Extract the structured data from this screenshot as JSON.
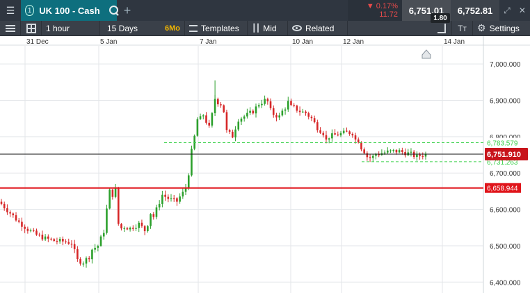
{
  "titlebar": {
    "tab_number": "1",
    "instrument": "UK 100 - Cash",
    "change_pct": "▼ 0.17%",
    "change_pts": "11.72",
    "sell": "6,751.01",
    "buy": "6,752.81",
    "spread": "1.80"
  },
  "toolbar": {
    "interval": "1 hour",
    "range": "15 Days",
    "range_tag": "6Mo",
    "templates": "Templates",
    "price_type": "Mid",
    "related": "Related",
    "settings": "Settings"
  },
  "colors": {
    "up": "#2ca02c",
    "down": "#d62728",
    "support_line": "#e0151b",
    "bracket_line": "#3ad14a",
    "current_line": "#111111",
    "current_badge": "#c8141b"
  },
  "chart_data": {
    "type": "candlestick",
    "x_tick_labels": [
      "31 Dec",
      "5 Jan",
      "7 Jan",
      "10 Jan",
      "12 Jan",
      "14 Jan"
    ],
    "y_ticks": [
      6400,
      6500,
      6600,
      6700,
      6800,
      6900,
      7000
    ],
    "y_tick_labels": [
      "6,400.000",
      "6,500.000",
      "6,600.000",
      "6,700.000",
      "6,800.000",
      "6,900.000",
      "7,000.000"
    ],
    "ylim": [
      6370,
      7050
    ],
    "current_price": 6751.91,
    "current_label": "6,751.910",
    "horizontal_line": {
      "value": 6658.944,
      "label": "6,658.944"
    },
    "bracket_upper": {
      "value": 6783.579,
      "label": "6,783.579"
    },
    "bracket_lower": {
      "value": 6731.263,
      "label": "6,731.263"
    },
    "close_path": [
      [
        0,
        6615
      ],
      [
        3,
        6590
      ],
      [
        6,
        6565
      ],
      [
        9,
        6545
      ],
      [
        12,
        6530
      ],
      [
        15,
        6520
      ],
      [
        18,
        6514
      ],
      [
        21,
        6512
      ],
      [
        24,
        6508
      ],
      [
        26,
        6460
      ],
      [
        28,
        6455
      ],
      [
        30,
        6470
      ],
      [
        31,
        6490
      ],
      [
        33,
        6500
      ],
      [
        35,
        6540
      ],
      [
        36,
        6600
      ],
      [
        37,
        6650
      ],
      [
        38,
        6640
      ],
      [
        39,
        6655
      ],
      [
        40,
        6560
      ],
      [
        41,
        6548
      ],
      [
        42,
        6552
      ],
      [
        44,
        6548
      ],
      [
        46,
        6556
      ],
      [
        47,
        6560
      ],
      [
        49,
        6542
      ],
      [
        50,
        6560
      ],
      [
        51,
        6590
      ],
      [
        52,
        6580
      ],
      [
        53,
        6600
      ],
      [
        55,
        6640
      ],
      [
        57,
        6630
      ],
      [
        59,
        6624
      ],
      [
        60,
        6622
      ],
      [
        61,
        6635
      ],
      [
        62,
        6645
      ],
      [
        63,
        6660
      ],
      [
        64,
        6700
      ],
      [
        65,
        6760
      ],
      [
        66,
        6800
      ],
      [
        67,
        6848
      ],
      [
        68,
        6850
      ],
      [
        69,
        6860
      ],
      [
        70,
        6842
      ],
      [
        71,
        6825
      ],
      [
        72,
        6860
      ],
      [
        73,
        6905
      ],
      [
        74,
        6895
      ],
      [
        75,
        6890
      ],
      [
        76,
        6870
      ],
      [
        77,
        6815
      ],
      [
        78,
        6808
      ],
      [
        79,
        6802
      ],
      [
        80,
        6825
      ],
      [
        81,
        6848
      ],
      [
        82,
        6852
      ],
      [
        84,
        6860
      ],
      [
        86,
        6870
      ],
      [
        88,
        6890
      ],
      [
        90,
        6900
      ],
      [
        91,
        6896
      ],
      [
        92,
        6872
      ],
      [
        93,
        6862
      ],
      [
        94,
        6858
      ],
      [
        95,
        6855
      ],
      [
        96,
        6870
      ],
      [
        97,
        6880
      ],
      [
        98,
        6895
      ],
      [
        99,
        6882
      ],
      [
        100,
        6880
      ],
      [
        102,
        6870
      ],
      [
        104,
        6865
      ],
      [
        106,
        6850
      ],
      [
        108,
        6825
      ],
      [
        110,
        6810
      ],
      [
        111,
        6790
      ],
      [
        112,
        6800
      ],
      [
        114,
        6805
      ],
      [
        116,
        6808
      ],
      [
        118,
        6812
      ],
      [
        120,
        6810
      ],
      [
        121,
        6792
      ],
      [
        122,
        6790
      ],
      [
        123,
        6770
      ],
      [
        124,
        6760
      ],
      [
        125,
        6745
      ],
      [
        126,
        6742
      ],
      [
        127,
        6745
      ],
      [
        128,
        6752
      ],
      [
        130,
        6755
      ],
      [
        132,
        6758
      ],
      [
        134,
        6760
      ],
      [
        136,
        6760
      ],
      [
        138,
        6756
      ],
      [
        140,
        6752
      ],
      [
        141,
        6748
      ],
      [
        142,
        6745
      ],
      [
        143,
        6748
      ],
      [
        144,
        6750
      ],
      [
        145,
        6751.91
      ]
    ]
  }
}
